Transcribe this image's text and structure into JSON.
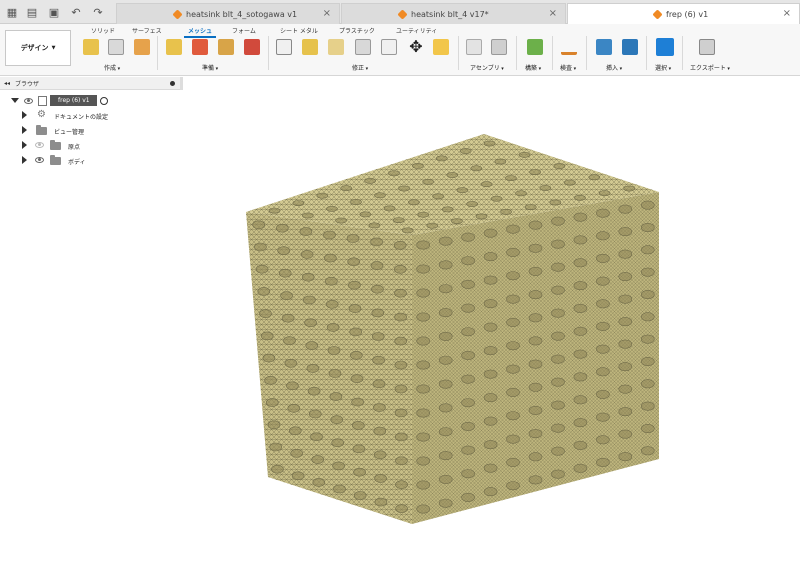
{
  "titlebar": {
    "tabs": [
      {
        "label": "heatsink blt_4_sotogawa v1",
        "active": false
      },
      {
        "label": "heatsink blt_4 v17*",
        "active": false
      },
      {
        "label": "frep (6) v1",
        "active": true
      }
    ],
    "close_glyph": "×"
  },
  "ribbon": {
    "workspace": "デザイン",
    "tabs": [
      "ソリッド",
      "サーフェス",
      "メッシュ",
      "フォーム",
      "シート メタル",
      "プラスチック",
      "ユーティリティ"
    ],
    "active_tab": "メッシュ",
    "groups": [
      "作成",
      "準備",
      "修正",
      "アセンブリ",
      "構築",
      "検査",
      "挿入",
      "選択",
      "エクスポート"
    ]
  },
  "browser": {
    "title": "ブラウザ",
    "root": "frep (6) v1",
    "items": [
      "ドキュメントの設定",
      "ビュー管理",
      "原点",
      "ボディ"
    ]
  },
  "colors": {
    "mesh_fill": "#c7be86",
    "mesh_dark": "#8f8658",
    "mesh_line": "#6f6a48",
    "accent": "#0a6fc2"
  }
}
